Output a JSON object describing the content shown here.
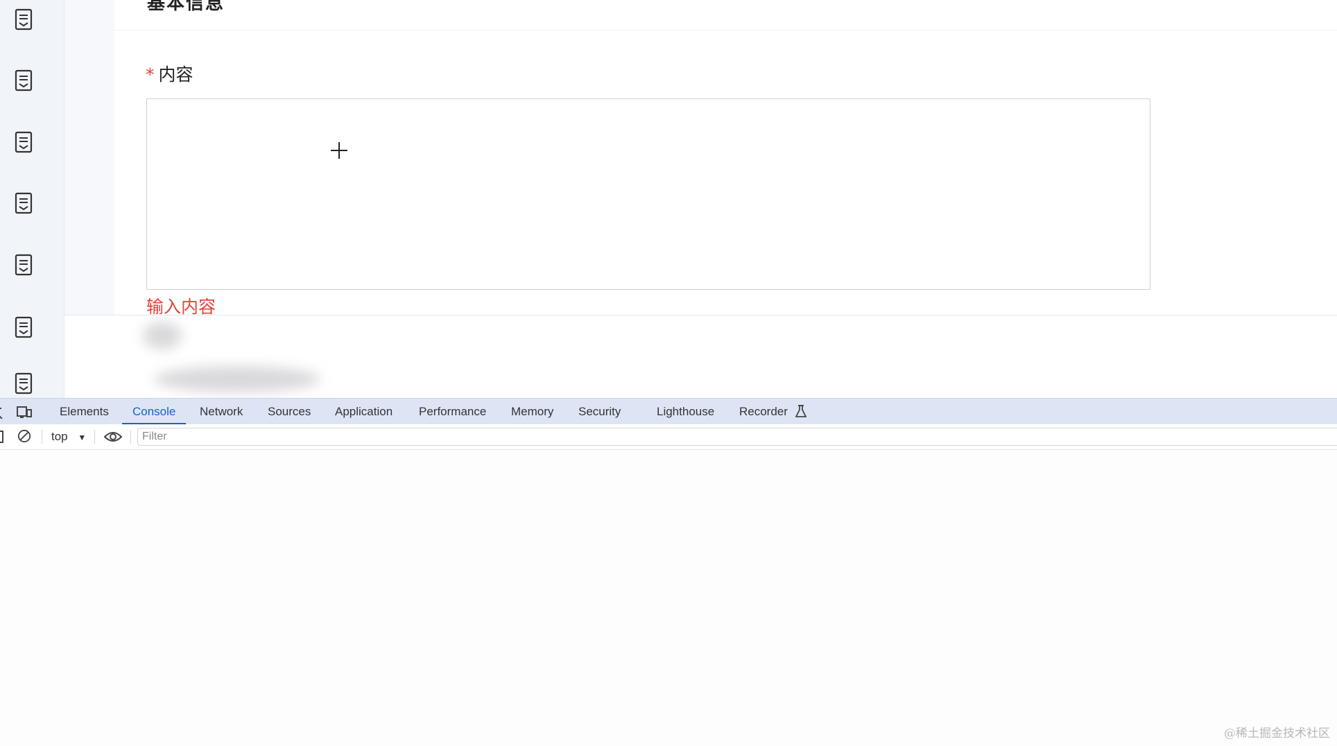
{
  "page": {
    "partial_title": "基本信息",
    "field_label": "内容",
    "required_mark": "*",
    "error_message": "输入内容",
    "watermark": "@稀土掘金技术社区"
  },
  "rail": {
    "icons": [
      "document-list-icon",
      "document-list-icon",
      "document-list-icon",
      "document-list-icon",
      "document-list-icon",
      "document-list-icon",
      "document-list-icon"
    ]
  },
  "devtools": {
    "tabs": [
      {
        "label": "Elements",
        "active": false
      },
      {
        "label": "Console",
        "active": true
      },
      {
        "label": "Network",
        "active": false
      },
      {
        "label": "Sources",
        "active": false
      },
      {
        "label": "Application",
        "active": false
      },
      {
        "label": "Performance",
        "active": false
      },
      {
        "label": "Memory",
        "active": false
      },
      {
        "label": "Security",
        "active": false
      },
      {
        "label": "Lighthouse",
        "active": false
      },
      {
        "label": "Recorder",
        "active": false
      }
    ],
    "context_selector": "top",
    "filter_placeholder": "Filter",
    "accent_color": "#1a5fd0"
  }
}
